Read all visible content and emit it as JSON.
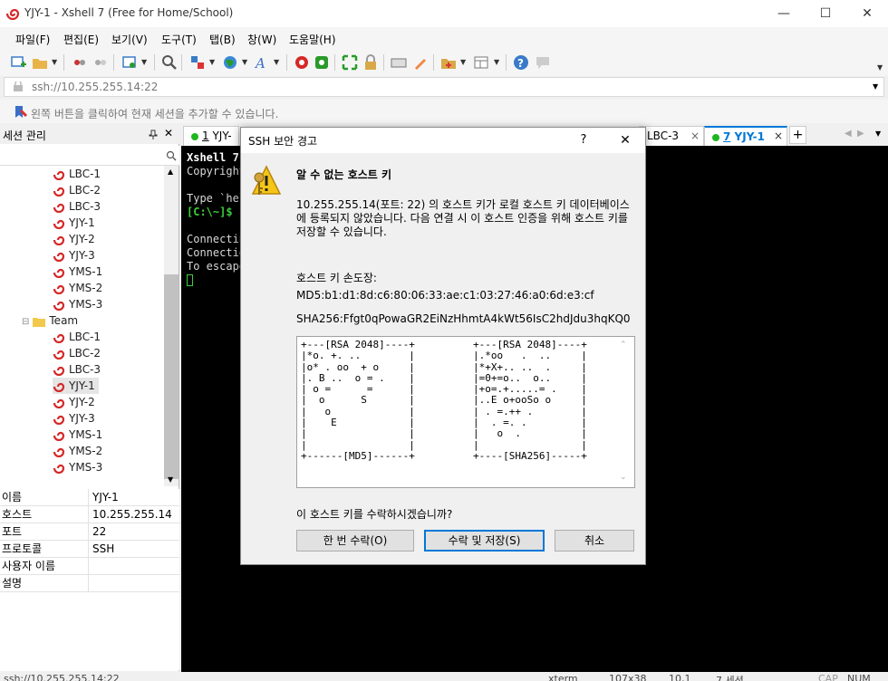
{
  "window": {
    "title": "YJY-1 - Xshell 7 (Free for Home/School)",
    "minimize": "—",
    "maximize": "☐",
    "close": "✕"
  },
  "menu": [
    "파일(F)",
    "편집(E)",
    "보기(V)",
    "도구(T)",
    "탭(B)",
    "창(W)",
    "도움말(H)"
  ],
  "address": "ssh://10.255.255.14:22",
  "infobar_text": "왼쪽 버튼을 클릭하여 현재 세션을 추가할 수 있습니다.",
  "session_panel": {
    "title": "세션 관리",
    "pin": "📌",
    "close": "✕",
    "tree": [
      {
        "label": "LBC-1",
        "indent": 1
      },
      {
        "label": "LBC-2",
        "indent": 1
      },
      {
        "label": "LBC-3",
        "indent": 1
      },
      {
        "label": "YJY-1",
        "indent": 1
      },
      {
        "label": "YJY-2",
        "indent": 1
      },
      {
        "label": "YJY-3",
        "indent": 1
      },
      {
        "label": "YMS-1",
        "indent": 1
      },
      {
        "label": "YMS-2",
        "indent": 1
      },
      {
        "label": "YMS-3",
        "indent": 1
      },
      {
        "label": "Team",
        "indent": 0,
        "folder": true
      },
      {
        "label": "LBC-1",
        "indent": 1
      },
      {
        "label": "LBC-2",
        "indent": 1
      },
      {
        "label": "LBC-3",
        "indent": 1
      },
      {
        "label": "YJY-1",
        "indent": 1,
        "selected": true
      },
      {
        "label": "YJY-2",
        "indent": 1
      },
      {
        "label": "YJY-3",
        "indent": 1
      },
      {
        "label": "YMS-1",
        "indent": 1
      },
      {
        "label": "YMS-2",
        "indent": 1
      },
      {
        "label": "YMS-3",
        "indent": 1
      }
    ]
  },
  "properties": [
    {
      "key": "이름",
      "value": "YJY-1"
    },
    {
      "key": "호스트",
      "value": "10.255.255.14"
    },
    {
      "key": "포트",
      "value": "22"
    },
    {
      "key": "프로토콜",
      "value": "SSH"
    },
    {
      "key": "사용자 이름",
      "value": ""
    },
    {
      "key": "설명",
      "value": ""
    }
  ],
  "tabs": {
    "first": {
      "num": "1",
      "label": "YJY-1"
    },
    "lbc3": {
      "label": "LBC-3",
      "close": "×"
    },
    "active": {
      "num": "7",
      "label": "YJY-1",
      "close": "×"
    },
    "add": "+"
  },
  "terminal": {
    "lines": [
      "Xshell 7",
      "Copyright",
      "",
      "Type `hel",
      "[C:\\~]$",
      "",
      "Connectin",
      "Connectio",
      "To escape"
    ]
  },
  "status": {
    "left": "ssh://10.255.255.14:22",
    "term": "xterm",
    "size": "107x38",
    "pos": "10,1",
    "sessions": "7 세션",
    "cap": "CAP",
    "num": "NUM"
  },
  "dialog": {
    "title": "SSH 보안 경고",
    "help": "?",
    "close": "✕",
    "heading": "알 수 없는 호스트 키",
    "message": "10.255.255.14(포트: 22) 의 호스트 키가 로컬 호스트 키 데이터베이스에 등록되지 않았습니다. 다음 연결 시 이 호스트 인증을 위해 호스트 키를 저장할 수 있습니다.",
    "fp_label": "호스트 키 손도장:",
    "md5": "MD5:b1:d1:8d:c6:80:06:33:ae:c1:03:27:46:a0:6d:e3:cf",
    "sha256": "SHA256:Ffgt0qPowaGR2EiNzHhmtA4kWt56IsC2hdJdu3hqKQ0",
    "art_md5": "+---[RSA 2048]----+\n|*o. +. ..        |\n|o* . oo  + o     |\n|. B ..  o = .    |\n| o =      =      |\n|  o      S       |\n|   o             |\n|    E            |\n|                 |\n|                 |\n+------[MD5]------+",
    "art_sha": "+---[RSA 2048]----+\n|.*oo   .  ..     |\n|*+X+.. ..  .     |\n|=0+=o..  o..     |\n|+o=.+.....= .    |\n|..E o+ooSo o     |\n| . =.++ .        |\n|  . =. .         |\n|   o  .          |\n|                 |\n+----[SHA256]-----+",
    "question": "이 호스트 키를 수락하시겠습니까?",
    "btn_once": "한 번 수락(O)",
    "btn_save": "수락 및 저장(S)",
    "btn_cancel": "취소"
  }
}
